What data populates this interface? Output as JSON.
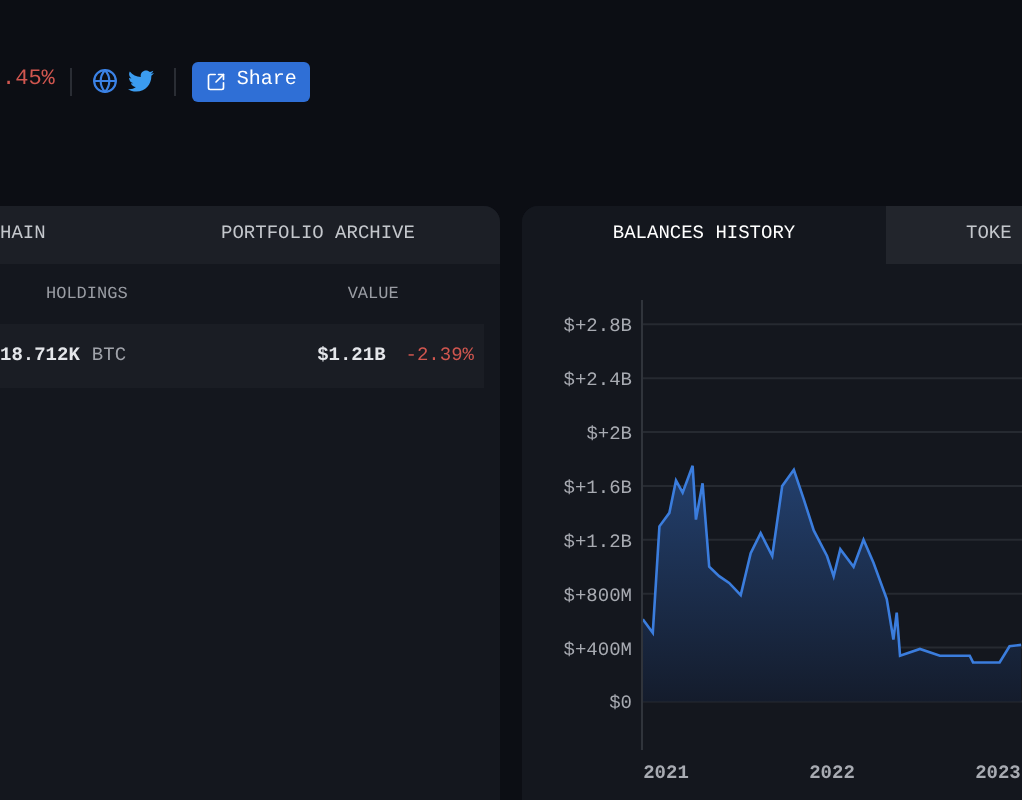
{
  "header": {
    "change": ".45%",
    "share_button": "Share"
  },
  "holdings_panel": {
    "tabs": [
      {
        "label": "HAIN",
        "selected": false
      },
      {
        "label": "PORTFOLIO ARCHIVE",
        "selected": false
      }
    ],
    "columns": [
      "HOLDINGS",
      "VALUE"
    ],
    "rows": [
      {
        "amount": "18.712K",
        "token": "BTC",
        "value": "$1.21B",
        "change": "-2.39%"
      }
    ]
  },
  "history_panel": {
    "tabs": [
      {
        "label": "BALANCES HISTORY",
        "selected": true
      },
      {
        "label": "TOKE",
        "selected": false
      }
    ],
    "chart_data": {
      "type": "area",
      "x": [
        2020.86,
        2020.92,
        2020.96,
        2021.02,
        2021.06,
        2021.1,
        2021.16,
        2021.18,
        2021.22,
        2021.26,
        2021.32,
        2021.38,
        2021.45,
        2021.51,
        2021.57,
        2021.64,
        2021.7,
        2021.77,
        2021.83,
        2021.89,
        2021.97,
        2022.01,
        2022.05,
        2022.13,
        2022.19,
        2022.25,
        2022.33,
        2022.37,
        2022.39,
        2022.41,
        2022.53,
        2022.65,
        2022.83,
        2022.85,
        2023.01,
        2023.07,
        2023.14
      ],
      "series": [
        {
          "color": "#3b7ddd",
          "values": [
            610000000,
            510000000,
            1300000000,
            1400000000,
            1640000000,
            1550000000,
            1750000000,
            1350000000,
            1620000000,
            1000000000,
            930000000,
            880000000,
            790000000,
            1100000000,
            1250000000,
            1080000000,
            1600000000,
            1720000000,
            1500000000,
            1270000000,
            1080000000,
            930000000,
            1130000000,
            1000000000,
            1200000000,
            1030000000,
            760000000,
            460000000,
            660000000,
            340000000,
            390000000,
            340000000,
            340000000,
            290000000,
            290000000,
            410000000,
            420000000
          ]
        }
      ],
      "xlim": [
        2020.855,
        2023.145
      ],
      "ylim": [
        -360000000,
        2980000000
      ],
      "grid": true,
      "xticks": [
        {
          "value": 2021,
          "label": "2021"
        },
        {
          "value": 2022,
          "label": "2022"
        },
        {
          "value": 2023,
          "label": "2023"
        }
      ],
      "yticks": [
        {
          "value": 0,
          "label": "$0"
        },
        {
          "value": 400000000,
          "label": "$+400M"
        },
        {
          "value": 800000000,
          "label": "$+800M"
        },
        {
          "value": 1200000000,
          "label": "$+1.2B"
        },
        {
          "value": 1600000000,
          "label": "$+1.6B"
        },
        {
          "value": 2000000000,
          "label": "$+2B"
        },
        {
          "value": 2400000000,
          "label": "$+2.4B"
        },
        {
          "value": 2800000000,
          "label": "$+2.8B"
        }
      ]
    }
  }
}
